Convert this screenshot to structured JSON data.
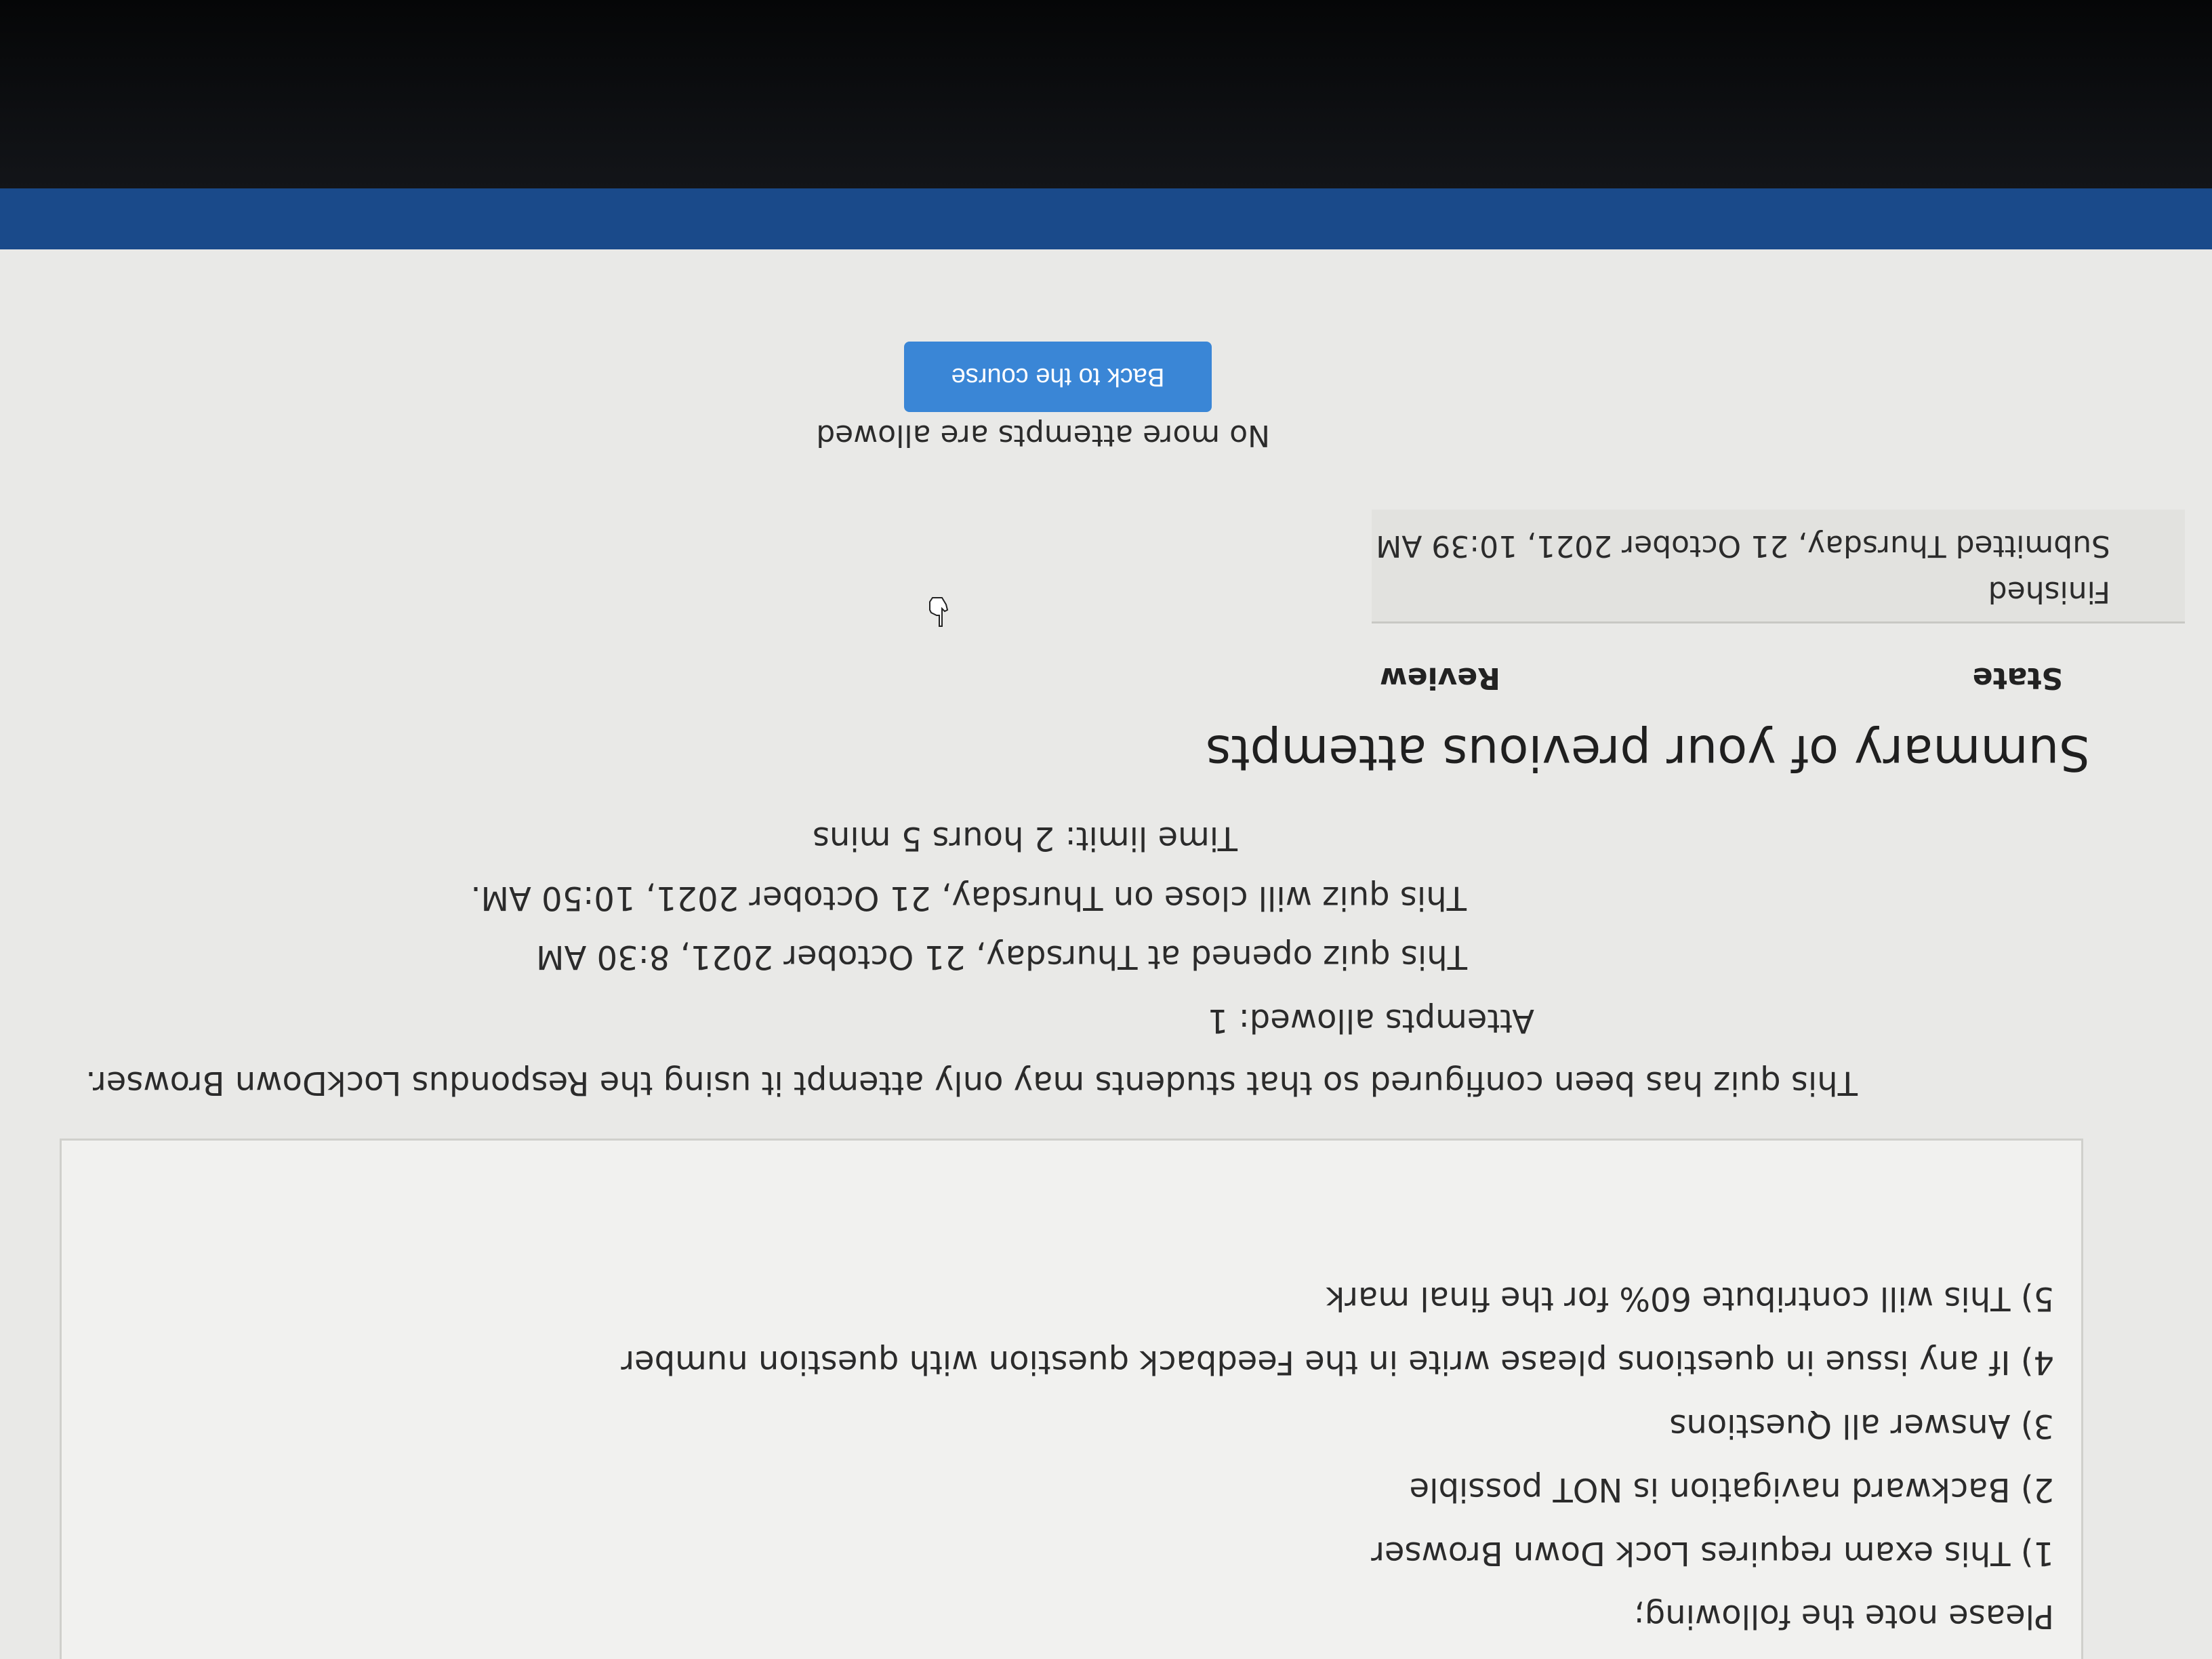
{
  "notes": {
    "intro": "Please note the following;",
    "items": [
      "1) This exam requires Lock Down Browser",
      "2) Backward navigation is NOT possible",
      "3) Answer all Questions",
      "4) If any issue in questions please write in the Feedback question with question number",
      "5) This will contribute 60% for the final mark"
    ]
  },
  "quiz_info": {
    "lockdown": "This quiz has been configured so that students may only attempt it using the Respondus LockDown Browser.",
    "attempts_allowed": "Attempts allowed: 1",
    "opened": "This quiz opened at Thursday, 21 October 2021, 8:30 AM",
    "closes": "This quiz will close on Thursday, 21 October 2021, 10:50 AM.",
    "time_limit": "Time limit: 2 hours 5 mins"
  },
  "summary": {
    "heading": "Summary of your previous attempts",
    "columns": [
      "State",
      "Review"
    ],
    "rows": [
      {
        "state": "Finished",
        "submitted": "Submitted Thursday, 21 October 2021, 10:39 AM"
      }
    ]
  },
  "footer": {
    "no_more_attempts": "No more attempts are allowed",
    "back_button": "Back to the course"
  },
  "colors": {
    "button": "#3a86d6",
    "taskbar": "#1a4a8a",
    "background": "#e9e9e7"
  },
  "icons": {
    "cursor": "hand-pointer"
  }
}
